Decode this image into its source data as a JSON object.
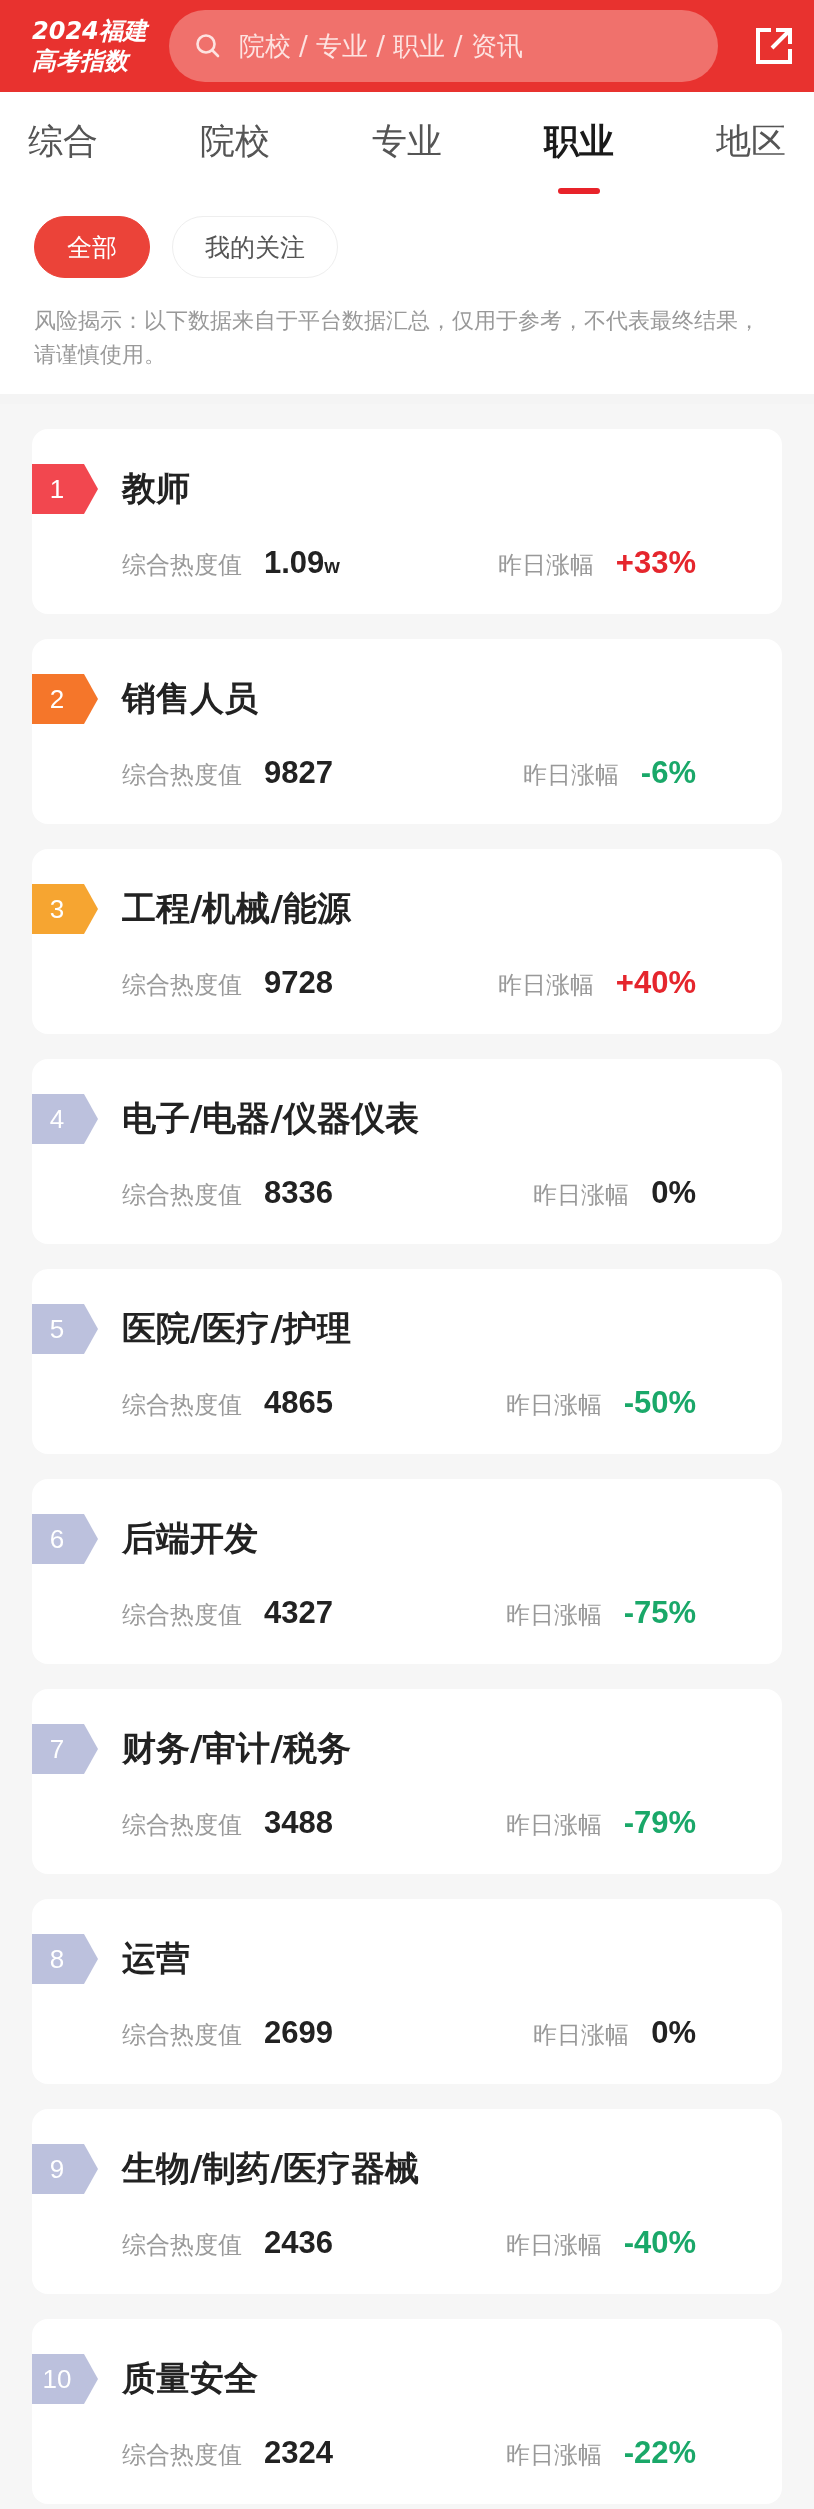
{
  "header": {
    "logo_year": "2024福建",
    "logo_title": "高考指数",
    "search": {
      "placeholder": "院校 / 专业 / 职业 / 资讯"
    }
  },
  "tabs": [
    {
      "label": "综合",
      "selected": false
    },
    {
      "label": "院校",
      "selected": false
    },
    {
      "label": "专业",
      "selected": false
    },
    {
      "label": "职业",
      "selected": true
    },
    {
      "label": "地区",
      "selected": false
    }
  ],
  "filters": [
    {
      "label": "全部",
      "selected": true
    },
    {
      "label": "我的关注",
      "selected": false
    }
  ],
  "notice": "风险揭示：以下数据来自于平台数据汇总，仅用于参考，不代表最终结果，请谨慎使用。",
  "ranking": [
    {
      "rank": "1",
      "color": "#f2474f",
      "name": "教师",
      "heat_label": "综合热度值",
      "heat": "1.09",
      "unit": "w",
      "change_label": "昨日涨幅",
      "change": "+33%",
      "kind": "up"
    },
    {
      "rank": "2",
      "color": "#f5762a",
      "name": "销售人员",
      "heat_label": "综合热度值",
      "heat": "9827",
      "change_label": "昨日涨幅",
      "change": "-6%",
      "kind": "down"
    },
    {
      "rank": "3",
      "color": "#f6a531",
      "name": "工程/机械/能源",
      "heat_label": "综合热度值",
      "heat": "9728",
      "change_label": "昨日涨幅",
      "change": "+40%",
      "kind": "up"
    },
    {
      "rank": "4",
      "color": "#bcc1dd",
      "name": "电子/电器/仪器仪表",
      "heat_label": "综合热度值",
      "heat": "8336",
      "change_label": "昨日涨幅",
      "change": "0%",
      "kind": "flat"
    },
    {
      "rank": "5",
      "color": "#bcc1dd",
      "name": "医院/医疗/护理",
      "heat_label": "综合热度值",
      "heat": "4865",
      "change_label": "昨日涨幅",
      "change": "-50%",
      "kind": "down"
    },
    {
      "rank": "6",
      "color": "#bcc1dd",
      "name": "后端开发",
      "heat_label": "综合热度值",
      "heat": "4327",
      "change_label": "昨日涨幅",
      "change": "-75%",
      "kind": "down"
    },
    {
      "rank": "7",
      "color": "#bcc1dd",
      "name": "财务/审计/税务",
      "heat_label": "综合热度值",
      "heat": "3488",
      "change_label": "昨日涨幅",
      "change": "-79%",
      "kind": "down"
    },
    {
      "rank": "8",
      "color": "#bcc1dd",
      "name": "运营",
      "heat_label": "综合热度值",
      "heat": "2699",
      "change_label": "昨日涨幅",
      "change": "0%",
      "kind": "flat"
    },
    {
      "rank": "9",
      "color": "#bcc1dd",
      "name": "生物/制药/医疗器械",
      "heat_label": "综合热度值",
      "heat": "2436",
      "change_label": "昨日涨幅",
      "change": "-40%",
      "kind": "down"
    },
    {
      "rank": "10",
      "color": "#bcc1dd",
      "name": "质量安全",
      "heat_label": "综合热度值",
      "heat": "2324",
      "change_label": "昨日涨幅",
      "change": "-22%",
      "kind": "down"
    }
  ]
}
